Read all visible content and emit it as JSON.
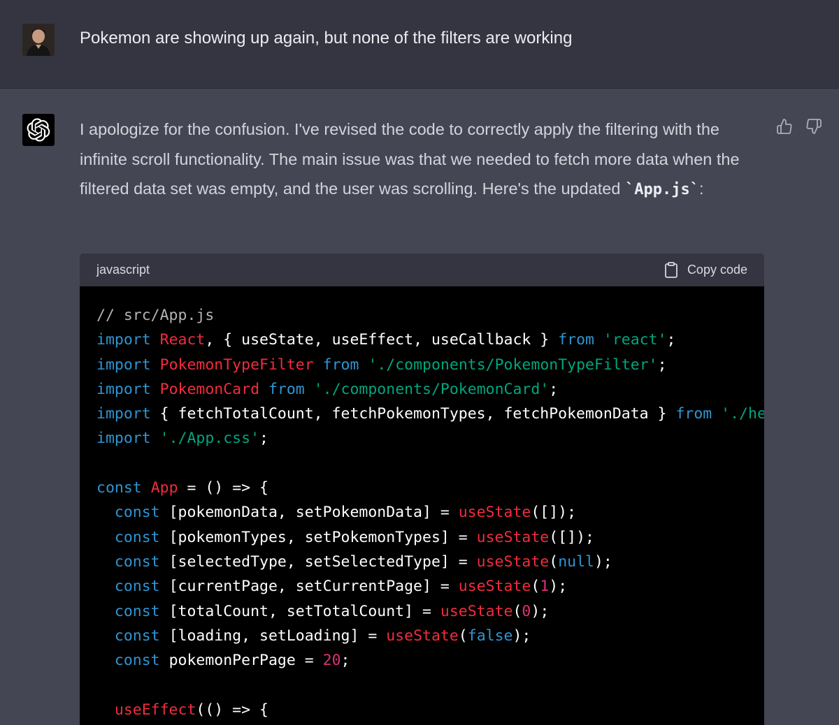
{
  "user_message": {
    "text": "Pokemon are showing up again, but none of the filters are working"
  },
  "assistant_message": {
    "text_part1": "I apologize for the confusion. I've revised the code to correctly apply the filtering with the infinite scroll functionality. The main issue was that we needed to fetch more data when the filtered data set was empty, and the user was scrolling. Here's the updated ",
    "inline_code": "`App.js`",
    "text_part2": ":"
  },
  "feedback": {
    "thumbs_up_icon": "thumbs-up-icon",
    "thumbs_down_icon": "thumbs-down-icon"
  },
  "code_block": {
    "language": "javascript",
    "copy_label": "Copy code",
    "lines": [
      [
        [
          "comment",
          "// src/App.js"
        ]
      ],
      [
        [
          "kw",
          "import"
        ],
        [
          "plain",
          " "
        ],
        [
          "red",
          "React"
        ],
        [
          "plain",
          ", { useState, useEffect, useCallback } "
        ],
        [
          "kw",
          "from"
        ],
        [
          "plain",
          " "
        ],
        [
          "str",
          "'react'"
        ],
        [
          "plain",
          ";"
        ]
      ],
      [
        [
          "kw",
          "import"
        ],
        [
          "plain",
          " "
        ],
        [
          "red",
          "PokemonTypeFilter"
        ],
        [
          "plain",
          " "
        ],
        [
          "kw",
          "from"
        ],
        [
          "plain",
          " "
        ],
        [
          "str",
          "'./components/PokemonTypeFilter'"
        ],
        [
          "plain",
          ";"
        ]
      ],
      [
        [
          "kw",
          "import"
        ],
        [
          "plain",
          " "
        ],
        [
          "red",
          "PokemonCard"
        ],
        [
          "plain",
          " "
        ],
        [
          "kw",
          "from"
        ],
        [
          "plain",
          " "
        ],
        [
          "str",
          "'./components/PokemonCard'"
        ],
        [
          "plain",
          ";"
        ]
      ],
      [
        [
          "kw",
          "import"
        ],
        [
          "plain",
          " { fetchTotalCount, fetchPokemonTypes, fetchPokemonData } "
        ],
        [
          "kw",
          "from"
        ],
        [
          "plain",
          " "
        ],
        [
          "str",
          "'./hel"
        ]
      ],
      [
        [
          "kw",
          "import"
        ],
        [
          "plain",
          " "
        ],
        [
          "str",
          "'./App.css'"
        ],
        [
          "plain",
          ";"
        ]
      ],
      [
        [
          "plain",
          ""
        ]
      ],
      [
        [
          "kw",
          "const"
        ],
        [
          "plain",
          " "
        ],
        [
          "red",
          "App"
        ],
        [
          "plain",
          " = () => {"
        ]
      ],
      [
        [
          "plain",
          "  "
        ],
        [
          "kw",
          "const"
        ],
        [
          "plain",
          " [pokemonData, setPokemonData] = "
        ],
        [
          "red",
          "useState"
        ],
        [
          "plain",
          "([]);"
        ]
      ],
      [
        [
          "plain",
          "  "
        ],
        [
          "kw",
          "const"
        ],
        [
          "plain",
          " [pokemonTypes, setPokemonTypes] = "
        ],
        [
          "red",
          "useState"
        ],
        [
          "plain",
          "([]);"
        ]
      ],
      [
        [
          "plain",
          "  "
        ],
        [
          "kw",
          "const"
        ],
        [
          "plain",
          " [selectedType, setSelectedType] = "
        ],
        [
          "red",
          "useState"
        ],
        [
          "plain",
          "("
        ],
        [
          "kw",
          "null"
        ],
        [
          "plain",
          ");"
        ]
      ],
      [
        [
          "plain",
          "  "
        ],
        [
          "kw",
          "const"
        ],
        [
          "plain",
          " [currentPage, setCurrentPage] = "
        ],
        [
          "red",
          "useState"
        ],
        [
          "plain",
          "("
        ],
        [
          "num",
          "1"
        ],
        [
          "plain",
          ");"
        ]
      ],
      [
        [
          "plain",
          "  "
        ],
        [
          "kw",
          "const"
        ],
        [
          "plain",
          " [totalCount, setTotalCount] = "
        ],
        [
          "red",
          "useState"
        ],
        [
          "plain",
          "("
        ],
        [
          "num",
          "0"
        ],
        [
          "plain",
          ");"
        ]
      ],
      [
        [
          "plain",
          "  "
        ],
        [
          "kw",
          "const"
        ],
        [
          "plain",
          " [loading, setLoading] = "
        ],
        [
          "red",
          "useState"
        ],
        [
          "plain",
          "("
        ],
        [
          "kw",
          "false"
        ],
        [
          "plain",
          ");"
        ]
      ],
      [
        [
          "plain",
          "  "
        ],
        [
          "kw",
          "const"
        ],
        [
          "plain",
          " pokemonPerPage = "
        ],
        [
          "num",
          "20"
        ],
        [
          "plain",
          ";"
        ]
      ],
      [
        [
          "plain",
          ""
        ]
      ],
      [
        [
          "plain",
          "  "
        ],
        [
          "red",
          "useEffect"
        ],
        [
          "plain",
          "(() => {"
        ]
      ]
    ]
  }
}
